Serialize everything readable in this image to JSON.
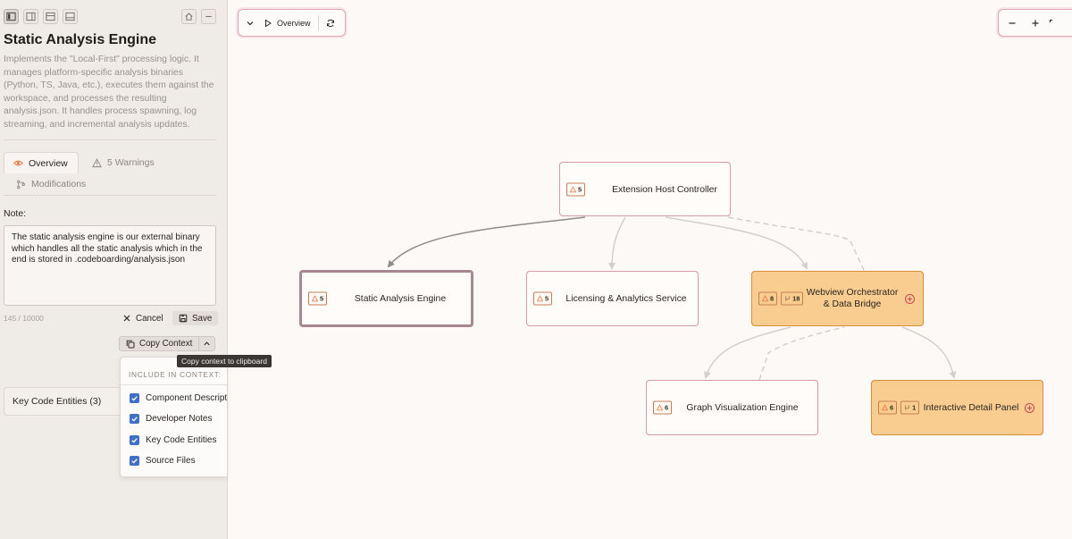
{
  "panel": {
    "title": "Static Analysis Engine",
    "description": "Implements the \"Local-First\" processing logic. It manages platform-specific analysis binaries (Python, TS, Java, etc.), executes them against the workspace, and processes the resulting analysis.json. It handles process spawning, log streaming, and incremental analysis updates.",
    "tabs": {
      "overview": "Overview",
      "warnings": "5 Warnings",
      "modifications": "Modifications"
    },
    "note_label": "Note:",
    "note_value": "The static analysis engine is our external binary which handles all the static analysis which in the end is stored in .codeboarding/analysis.json",
    "char_count": "145 / 10000",
    "cancel_label": "Cancel",
    "save_label": "Save",
    "copy_context_label": "Copy Context",
    "tooltip": "Copy context to clipboard",
    "key_entities": "Key Code Entities (3)",
    "context_menu": {
      "header": "INCLUDE IN CONTEXT:",
      "items": [
        {
          "label": "Component Descript",
          "checked": true
        },
        {
          "label": "Developer Notes",
          "checked": true
        },
        {
          "label": "Key Code Entities",
          "checked": true
        },
        {
          "label": "Source Files",
          "checked": true
        }
      ]
    }
  },
  "canvas": {
    "view_label": "Overview",
    "nodes": [
      {
        "id": "ehc",
        "label": "Extension Host Controller",
        "warnings": "5"
      },
      {
        "id": "sae",
        "label": "Static Analysis Engine",
        "warnings": "5"
      },
      {
        "id": "las",
        "label": "Licensing & Analytics Service",
        "warnings": "5"
      },
      {
        "id": "wod",
        "label_line1": "Webview Orchestrator",
        "label_line2": "& Data Bridge",
        "warnings": "8",
        "modifications": "18"
      },
      {
        "id": "gve",
        "label": "Graph Visualization Engine",
        "warnings": "6"
      },
      {
        "id": "idp",
        "label": "Interactive Detail Panel",
        "warnings": "6",
        "modifications": "1"
      }
    ]
  },
  "colors": {
    "accent_orange": "#e8743b",
    "highlight_node": "#f8cd8f",
    "node_border": "#d39aa8",
    "checkbox": "#3e70c8"
  }
}
